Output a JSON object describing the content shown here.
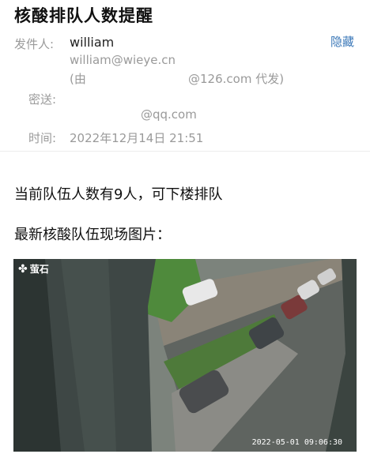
{
  "mail": {
    "subject": "核酸排队人数提醒",
    "hide_label": "隐藏",
    "from_label": "发件人:",
    "from_name": "william",
    "from_email": "william@wieye.cn",
    "proxy_prefix": "(由",
    "proxy_suffix": "@126.com 代发)",
    "bcc_label": "密送:",
    "bcc_value": "@qq.com",
    "time_label": "时间:",
    "time_value": "2022年12月14日 21:51"
  },
  "content": {
    "line1": "当前队伍人数有9人，可下楼排队",
    "line2": "最新核酸队伍现场图片："
  },
  "photo": {
    "brand": "萤石",
    "timestamp": "2022-05-01 09:06:30"
  }
}
